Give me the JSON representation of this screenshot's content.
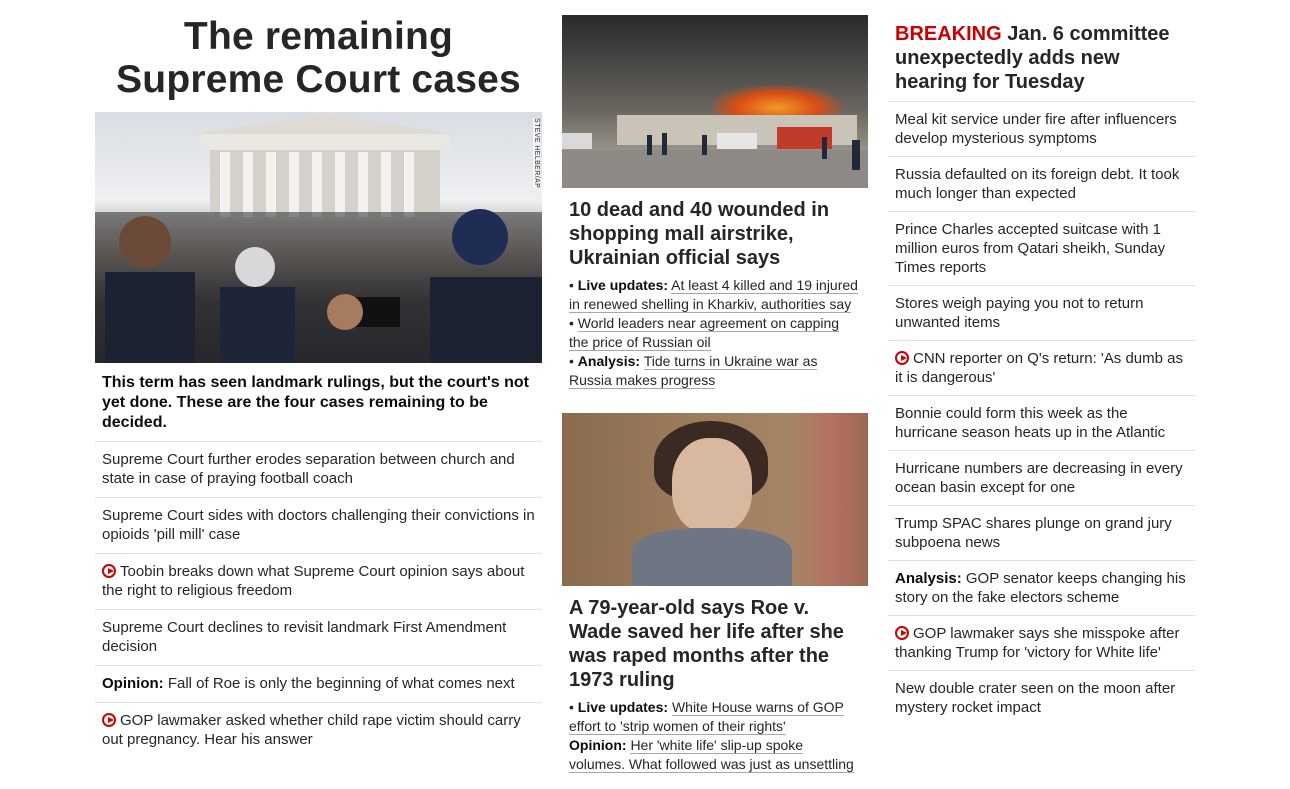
{
  "col1": {
    "title": "The remaining Supreme Court cases",
    "photo_credit": "STEVE HELBER/AP",
    "lead": "This term has seen landmark rulings, but the court's not yet done. These are the four cases remaining to be decided.",
    "items": [
      {
        "label": "",
        "text": "Supreme Court further erodes separation between church and state in case of praying football coach",
        "video": false
      },
      {
        "label": "",
        "text": "Supreme Court sides with doctors challenging their convictions in opioids 'pill mill' case",
        "video": false
      },
      {
        "label": "",
        "text": "Toobin breaks down what Supreme Court opinion says about the right to religious freedom",
        "video": true
      },
      {
        "label": "",
        "text": "Supreme Court declines to revisit landmark First Amendment decision",
        "video": false
      },
      {
        "label": "Opinion:",
        "text": "Fall of Roe is only the beginning of what comes next",
        "video": false
      },
      {
        "label": "",
        "text": "GOP lawmaker asked whether child rape victim should carry out pregnancy. Hear his answer",
        "video": true
      }
    ]
  },
  "col2": {
    "story1": {
      "headline": "10 dead and 40 wounded in shopping mall airstrike, Ukrainian official says",
      "b1_prefix": "• ",
      "b1_label": "Live updates:",
      "b1_text": "At least 4 killed and 19 injured in renewed shelling in Kharkiv, authorities say",
      "b2_prefix": "• ",
      "b2_text": "World leaders near agreement on capping the price of Russian oil",
      "b3_prefix": "• ",
      "b3_label": "Analysis:",
      "b3_text": "Tide turns in Ukraine war as Russia makes progress"
    },
    "story2": {
      "headline": "A 79-year-old says Roe v. Wade saved her life after she was raped months after the 1973 ruling",
      "b1_prefix": "• ",
      "b1_label": "Live updates:",
      "b1_text": "White House warns of GOP effort to 'strip women of their rights'",
      "b2_label": "Opinion:",
      "b2_text": "Her 'white life' slip-up spoke volumes. What followed was just as unsettling"
    }
  },
  "col3": {
    "breaking_tag": "BREAKING",
    "breaking_text": "Jan. 6 committee unexpectedly adds new hearing for Tuesday",
    "items": [
      {
        "label": "",
        "text": "Meal kit service under fire after influencers develop mysterious symptoms",
        "video": false
      },
      {
        "label": "",
        "text": "Russia defaulted on its foreign debt. It took much longer than expected",
        "video": false
      },
      {
        "label": "",
        "text": "Prince Charles accepted suitcase with 1 million euros from Qatari sheikh, Sunday Times reports",
        "video": false
      },
      {
        "label": "",
        "text": "Stores weigh paying you not to return unwanted items",
        "video": false
      },
      {
        "label": "",
        "text": "CNN reporter on Q's return: 'As dumb as it is dangerous'",
        "video": true
      },
      {
        "label": "",
        "text": "Bonnie could form this week as the hurricane season heats up in the Atlantic",
        "video": false
      },
      {
        "label": "",
        "text": "Hurricane numbers are decreasing in every ocean basin except for one",
        "video": false
      },
      {
        "label": "",
        "text": "Trump SPAC shares plunge on grand jury subpoena news",
        "video": false
      },
      {
        "label": "Analysis:",
        "text": "GOP senator keeps changing his story on the fake electors scheme",
        "video": false
      },
      {
        "label": "",
        "text": "GOP lawmaker says she misspoke after thanking Trump for 'victory for White life'",
        "video": true
      },
      {
        "label": "",
        "text": "New double crater seen on the moon after mystery rocket impact",
        "video": false
      }
    ]
  },
  "colors": {
    "breaking": "#cc0000",
    "video_icon": "#cc0000",
    "divider": "#e1e1e1"
  },
  "icons": {
    "video": "play-circle-icon"
  }
}
